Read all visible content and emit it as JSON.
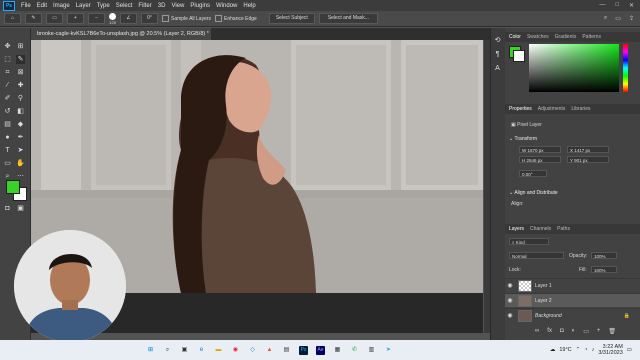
{
  "app": {
    "logo": "Ps"
  },
  "menu": [
    "File",
    "Edit",
    "Image",
    "Layer",
    "Type",
    "Select",
    "Filter",
    "3D",
    "View",
    "Plugins",
    "Window",
    "Help"
  ],
  "window_controls": [
    "—",
    "□",
    "✕"
  ],
  "options_bar": {
    "brush_size": "125",
    "angle": "0°",
    "sample_all_layers": "Sample All Layers",
    "enhance_edge": "Enhance Edge",
    "select_subject": "Select Subject",
    "select_and_mask": "Select and Mask..."
  },
  "document": {
    "tab_title": "brooke-cagle-kvKSL7B6eTo-unsplash.jpg @ 20.5% (Layer 2, RGB/8) *",
    "close": "✕"
  },
  "panels": {
    "color_tabs": [
      "Color",
      "Swatches",
      "Gradients",
      "Patterns"
    ],
    "properties_tabs": [
      "Properties",
      "Adjustments",
      "Libraries"
    ],
    "pixel_layer": "Pixel Layer",
    "transform": "Transform",
    "w": "W 1670 px",
    "h": "H 2646 px",
    "x": "X 1417 px",
    "y": "Y 901 px",
    "angle": "0.00°",
    "align_distribute": "Align and Distribute",
    "align": "Align:",
    "layers_tabs": [
      "Layers",
      "Channels",
      "Paths"
    ],
    "kind": "Kind",
    "blend": "Normal",
    "opacity_label": "Opacity:",
    "opacity": "100%",
    "lock_label": "Lock:",
    "fill_label": "Fill:",
    "fill": "100%",
    "layers": [
      {
        "name": "Layer 1"
      },
      {
        "name": "Layer 2"
      },
      {
        "name": "Background"
      }
    ]
  },
  "taskbar": {
    "weather": "19°C",
    "time": "3:22 AM",
    "date": "3/31/2023",
    "lang": "ENG"
  },
  "colors": {
    "foreground": "#3ad22a",
    "background": "#ffffff",
    "accent": "#31a8ff"
  }
}
